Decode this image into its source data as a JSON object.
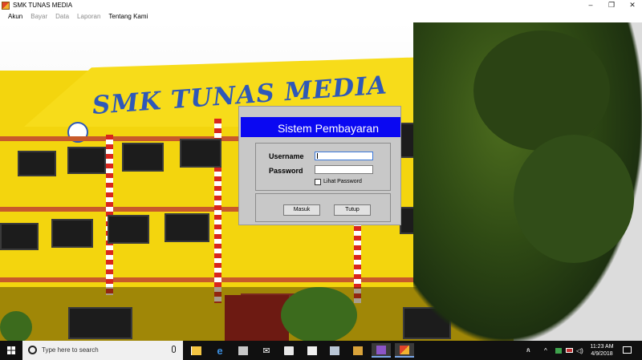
{
  "window": {
    "title": "SMK TUNAS MEDIA",
    "controls": {
      "minimize": "–",
      "maximize": "❐",
      "close": "✕"
    }
  },
  "menu": {
    "items": [
      {
        "label": "Akun",
        "enabled": true
      },
      {
        "label": "Bayar",
        "enabled": false
      },
      {
        "label": "Data",
        "enabled": false
      },
      {
        "label": "Laporan",
        "enabled": false
      },
      {
        "label": "Tentang Kami",
        "enabled": true
      }
    ]
  },
  "background": {
    "sign_text": "SMK TUNAS MEDIA"
  },
  "login": {
    "header": "Sistem Pembayaran",
    "username_label": "Username",
    "username_value": "",
    "password_label": "Password",
    "password_value": "",
    "show_password_label": "Lihat Password",
    "show_password_checked": false,
    "login_button": "Masuk",
    "close_button": "Tutup",
    "header_color": "#0a08f2"
  },
  "taskbar": {
    "search_placeholder": "Type here to search",
    "apps": [
      {
        "icon": "task-view-icon"
      },
      {
        "icon": "file-explorer-icon"
      },
      {
        "icon": "edge-icon"
      },
      {
        "icon": "store-icon"
      },
      {
        "icon": "mail-icon"
      },
      {
        "icon": "briefcase-icon"
      },
      {
        "icon": "sticky-notes-icon"
      },
      {
        "icon": "photos-icon"
      },
      {
        "icon": "media-player-icon"
      },
      {
        "icon": "visual-studio-icon"
      },
      {
        "icon": "running-app-icon"
      }
    ],
    "tray": {
      "clock_time": "11:23 AM",
      "clock_date": "4/9/2018"
    }
  }
}
